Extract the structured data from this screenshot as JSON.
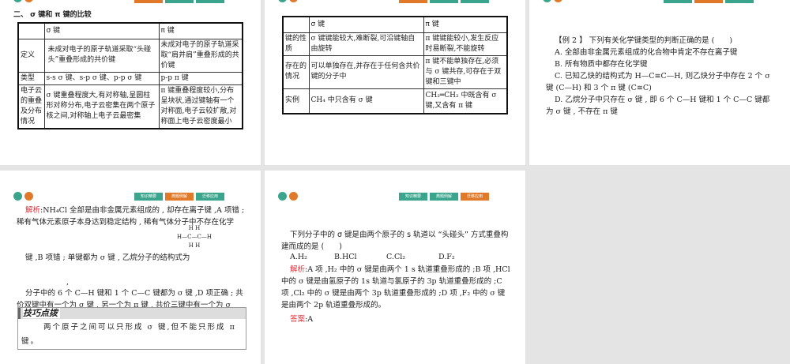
{
  "tabs": [
    "知识精要",
    "典题例解",
    "迁移应用"
  ],
  "slide1": {
    "title": "二、 σ 键和 π 键的比较",
    "header": [
      "",
      "σ 键",
      "π 键"
    ],
    "rows": [
      [
        "定义",
        "未成对电子的原子轨道采取“头碰头”重叠形成的共价键",
        "未成对电子的原子轨道采取“肩并肩”重叠形成的共价键"
      ],
      [
        "类型",
        "s-s σ 键、s-p σ 键、p-p σ 键",
        "p-p π 键"
      ],
      [
        "电子云的重叠及分布情况",
        "σ 键重叠程度大,有对称轴,呈圆柱形对称分布,电子云密集在两个原子核之间,对称轴上电子云最密集",
        "π 键重叠程度较小,分布呈块状,通过键轴有一个对称面,电子云较扩散,对称面上电子云密度最小"
      ]
    ]
  },
  "slide2": {
    "header": [
      "",
      "σ 键",
      "π 键"
    ],
    "rows": [
      [
        "键的性质",
        "σ 键键能较大,难断裂,可沿键轴自由旋转",
        "π 键键能较小,发生反应时易断裂,不能旋转"
      ],
      [
        "存在的情况",
        "可以单独存在,并存在于任何含共价键的分子中",
        "π 键不能单独存在,必须与 σ 键共存,可存在于双键和三键中"
      ],
      [
        "实例",
        "CH₄ 中只含有 σ 键",
        "CH₂═CH₂ 中既含有 σ 键,又含有 π 键"
      ]
    ]
  },
  "slide3": {
    "question": "【例 2 】 下列有关化学键类型的判断正确的是 (　　)",
    "options": [
      "A. 全部由非金属元素组成的化合物中肯定不存在离子键",
      "B. 所有物质中都存在化学键",
      "C. 已知乙炔的结构式为 H—C≡C—H, 则乙炔分子中存在 2 个 σ 键 (C—H) 和 3 个 π 键 (C≡C)",
      "D. 乙烷分子中只存在 σ 键 , 即 6 个 C—H 键和 1 个 C—C 键都为 σ 键 , 不存在 π 键"
    ]
  },
  "slide4": {
    "label": "解析",
    "line1": ":NH₄Cl 全部是由非金属元素组成的 , 却存在离子键 ,A 项错 ; 稀有气体元素原子本身达到稳定结构 , 稀有气体分子中不存在化学",
    "line2": "键 ,B 项错 ; 单键都为 σ 键 , 乙烷分子的结构式为",
    "comma": ",",
    "line3": "分子中的 6 个 C—H 键和 1 个 C—C 键都为 σ 键 ,D 项正确 ; 共价双键中有一个为 σ 键 , 另一个为 π 键 , 共价三键中有一个为 σ",
    "structure": {
      "top": "H  H",
      "mid": "H—C—C—H",
      "bot": "H  H"
    },
    "tip_title": "技巧点拨",
    "tip": "两个原子之间可以只形成 σ 键,但不能只形成 π 键。"
  },
  "slide5": {
    "question": "下列分子中的 σ 键是由两个原子的 s 轨道以 “头碰头” 方式重叠构建而成的是 (　　)",
    "options": [
      "A.H₂",
      "B.HCl",
      "C.Cl₂",
      "D.F₂"
    ],
    "label": "解析",
    "analysis": ":A 项 ,H₂ 中的 σ 键是由两个 1 s 轨道重叠形成的 ;B 项 ,HCl 中的 σ 键是由氢原子的 1s 轨道与氯原子的 3p 轨道重叠形成的 ;C 项 ,Cl₂ 中的 σ 键是由两个 3p 轨道重叠形成的 ;D 项 ,F₂ 中的 σ 键是由两个 2p 轨道重叠形成的。",
    "answer_label": "答案",
    "answer": ":A"
  }
}
